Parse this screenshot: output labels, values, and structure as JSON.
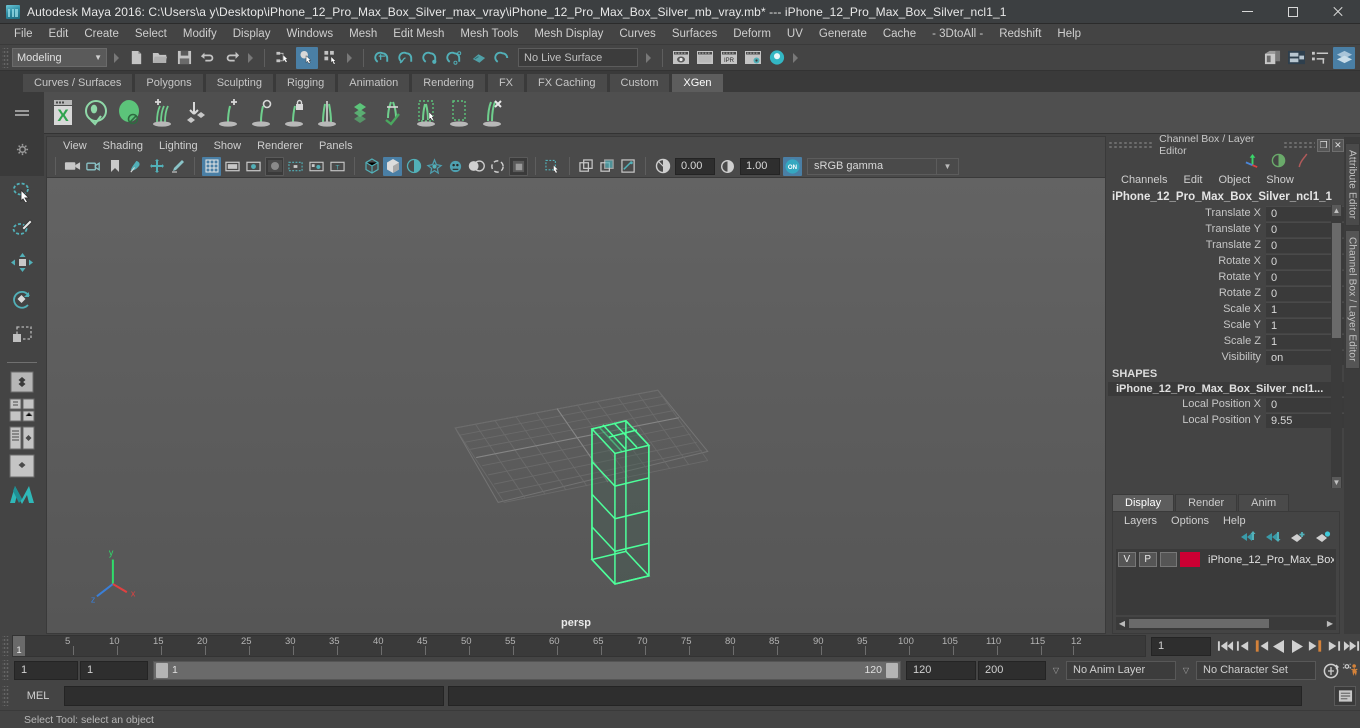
{
  "window": {
    "title": "Autodesk Maya 2016: C:\\Users\\a y\\Desktop\\iPhone_12_Pro_Max_Box_Silver_max_vray\\iPhone_12_Pro_Max_Box_Silver_mb_vray.mb*  ---  iPhone_12_Pro_Max_Box_Silver_ncl1_1",
    "minimize": "–",
    "maximize": "□",
    "close": "✕"
  },
  "menubar": {
    "items": [
      "File",
      "Edit",
      "Create",
      "Select",
      "Modify",
      "Display",
      "Windows",
      "Mesh",
      "Edit Mesh",
      "Mesh Tools",
      "Mesh Display",
      "Curves",
      "Surfaces",
      "Deform",
      "UV",
      "Generate",
      "Cache",
      "- 3DtoAll -",
      "Redshift",
      "Help"
    ]
  },
  "statusline": {
    "mode": "Modeling",
    "mode_arrow": "▼",
    "live_surface": "No Live Surface",
    "icons": [
      "new-scene-icon",
      "open-scene-icon",
      "save-scene-icon",
      "undo-icon",
      "redo-icon",
      "select-by-hierarchy-icon",
      "select-by-object-type-icon",
      "select-by-component-type-icon",
      "snap-to-grid-icon",
      "snap-to-curve-icon",
      "snap-to-point-icon",
      "snap-to-projected-center-icon",
      "snap-to-view-plane-icon",
      "make-live-icon",
      "render-current-frame-icon",
      "render-sequence-icon",
      "ipr-render-icon",
      "render-settings-icon",
      "hypershade-icon",
      "show-hide-editors-icon",
      "attribute-editor-icon",
      "tool-settings-icon",
      "channel-box-icon"
    ]
  },
  "shelf": {
    "tabs": [
      "Curves / Surfaces",
      "Polygons",
      "Sculpting",
      "Rigging",
      "Animation",
      "Rendering",
      "FX",
      "FX Caching",
      "Custom",
      "XGen"
    ],
    "active_tab": "XGen",
    "icons": [
      "xgen-editor-icon",
      "xgen-preview-icon",
      "xgen-render-icon",
      "xgen-add-groom-icon",
      "xgen-density-icon",
      "xgen-add-length-icon",
      "xgen-clump-icon",
      "xgen-lock-icon",
      "xgen-part-icon",
      "xgen-noise-icon",
      "xgen-cut-icon",
      "xgen-region-icon",
      "xgen-mask-icon",
      "xgen-remove-icon"
    ]
  },
  "toolbox": {
    "tools": [
      "select-tool",
      "lasso-select-tool",
      "paint-select-tool",
      "move-tool",
      "rotate-tool",
      "scale-tool"
    ],
    "active_tool": "select-tool",
    "layout_icons": [
      "single-perspective-view-icon",
      "four-view-icon",
      "persp-outliner-icon",
      "persp-graph-icon",
      "persp-hypershade-icon",
      "maya-logo-icon"
    ]
  },
  "viewport": {
    "menus": [
      "View",
      "Shading",
      "Lighting",
      "Show",
      "Renderer",
      "Panels"
    ],
    "camera_label": "persp",
    "exposure": "0.00",
    "gamma": "1.00",
    "color_space": "sRGB gamma",
    "color_space_arrow": "▼",
    "toolbar_icons": [
      "select-camera-icon",
      "camera-attributes-icon",
      "bookmark-icon",
      "image-plane-icon",
      "2d-pan-zoom-icon",
      "grease-pencil-icon",
      "grid-icon",
      "film-gate-icon",
      "resolution-gate-icon",
      "gate-mask-icon",
      "field-chart-icon",
      "safe-action-icon",
      "safe-title-icon",
      "wireframe-icon",
      "smooth-shade-icon",
      "shaded-wireframe-icon",
      "use-all-lights-icon",
      "shadows-icon",
      "ambient-occlusion-icon",
      "motion-blur-icon",
      "isolate-select-icon",
      "xray-icon",
      "xray-joints-icon",
      "xray-active-components-icon",
      "exposure-icon",
      "gamma-icon",
      "view-transform-toggle-icon"
    ]
  },
  "channelbox": {
    "panel_title": "Channel Box / Layer Editor",
    "float_btn": "❐",
    "close_btn": "✕",
    "menus": [
      "Channels",
      "Edit",
      "Object",
      "Show"
    ],
    "object_name": "iPhone_12_Pro_Max_Box_Silver_ncl1_1",
    "attributes": [
      {
        "label": "Translate X",
        "value": "0"
      },
      {
        "label": "Translate Y",
        "value": "0"
      },
      {
        "label": "Translate Z",
        "value": "0"
      },
      {
        "label": "Rotate X",
        "value": "0"
      },
      {
        "label": "Rotate Y",
        "value": "0"
      },
      {
        "label": "Rotate Z",
        "value": "0"
      },
      {
        "label": "Scale X",
        "value": "1"
      },
      {
        "label": "Scale Y",
        "value": "1"
      },
      {
        "label": "Scale Z",
        "value": "1"
      },
      {
        "label": "Visibility",
        "value": "on"
      }
    ],
    "shapes_header": "SHAPES",
    "shape_name": "iPhone_12_Pro_Max_Box_Silver_ncl1...",
    "shape_attributes": [
      {
        "label": "Local Position X",
        "value": "0"
      },
      {
        "label": "Local Position Y",
        "value": "9.55"
      }
    ],
    "side_tabs": [
      "Attribute Editor",
      "Channel Box / Layer Editor"
    ],
    "header_icons": [
      "transform-manip-icon",
      "lambert-sphere-icon",
      "curve-icon"
    ]
  },
  "layereditor": {
    "tabs": [
      "Display",
      "Render",
      "Anim"
    ],
    "active_tab": "Display",
    "menus": [
      "Layers",
      "Options",
      "Help"
    ],
    "buttons": [
      "move-layer-up-icon",
      "move-layer-down-icon",
      "new-layer-icon",
      "new-layer-from-selected-icon"
    ],
    "layers": [
      {
        "visibility": "V",
        "playback": "P",
        "state": "",
        "color": "#cc0033",
        "name": "iPhone_12_Pro_Max_Box"
      }
    ]
  },
  "timeline": {
    "current_frame": "1",
    "ticks": [
      "5",
      "10",
      "15",
      "20",
      "25",
      "30",
      "35",
      "40",
      "45",
      "50",
      "55",
      "60",
      "65",
      "70",
      "75",
      "80",
      "85",
      "90",
      "95",
      "100",
      "105",
      "110",
      "115",
      "12"
    ],
    "playback_buttons": [
      "go-to-start-icon",
      "step-back-keyframe-icon",
      "step-back-frame-icon",
      "play-backwards-icon",
      "play-forwards-icon",
      "step-forward-frame-icon",
      "step-forward-keyframe-icon",
      "go-to-end-icon"
    ]
  },
  "rangeslider": {
    "anim_start": "1",
    "range_start": "1",
    "slider_start_label": "1",
    "slider_end_label": "120",
    "range_end": "120",
    "anim_end": "200",
    "anim_layer": "No Anim Layer",
    "character_set": "No Character Set",
    "arrow": "▽",
    "auto_key_icon": "auto-keyframe-icon",
    "anim_prefs_icon": "animation-preferences-icon"
  },
  "commandline": {
    "language_label": "MEL",
    "input_value": "",
    "output_value": "",
    "script_editor_icon": "script-editor-icon"
  },
  "statusbar": {
    "message": "Select Tool: select an object"
  },
  "colors": {
    "accent_blue": "#4a7fa5",
    "teal": "#52b0b8",
    "selection_green": "#52ff9e",
    "orange": "#d98022",
    "layer_red": "#cc0033"
  }
}
